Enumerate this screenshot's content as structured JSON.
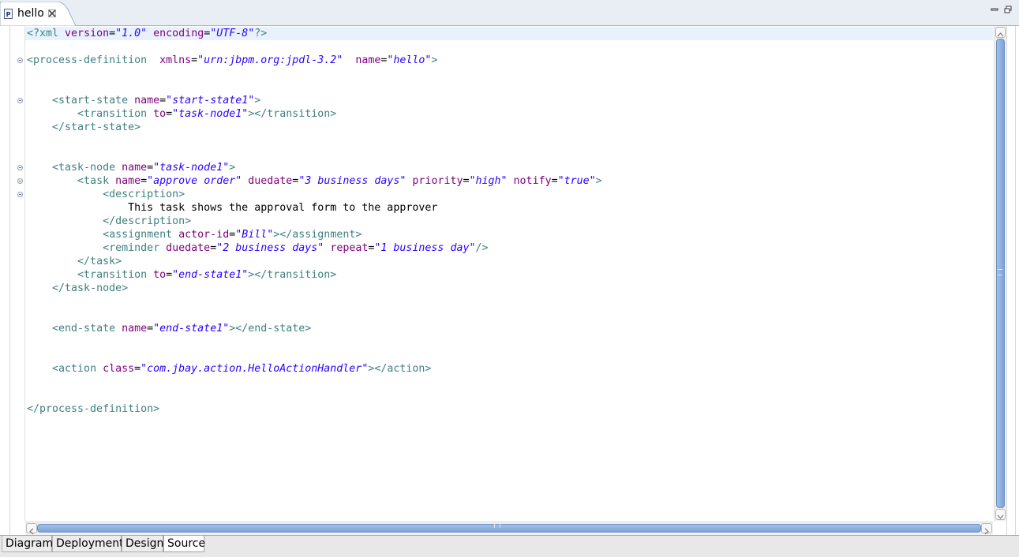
{
  "editor_tab": {
    "icon_letter": "P",
    "title": "hello"
  },
  "code_lines": [
    {
      "y": 0,
      "tokens": [
        [
          "t",
          "<?xml "
        ],
        [
          "a",
          "version"
        ],
        [
          "x",
          "="
        ],
        [
          "v",
          "\"1.0\""
        ],
        [
          "x",
          " "
        ],
        [
          "a",
          "encoding"
        ],
        [
          "x",
          "="
        ],
        [
          "v",
          "\"UTF-8\""
        ],
        [
          "t",
          "?>"
        ]
      ]
    },
    {
      "y": 2,
      "tokens": [
        [
          "t",
          "<process-definition  "
        ],
        [
          "a",
          "xmlns"
        ],
        [
          "x",
          "="
        ],
        [
          "v",
          "\"urn:jbpm.org:jpdl-3.2\""
        ],
        [
          "x",
          "  "
        ],
        [
          "a",
          "name"
        ],
        [
          "x",
          "="
        ],
        [
          "v",
          "\"hello\""
        ],
        [
          "t",
          ">"
        ]
      ]
    },
    {
      "y": 5,
      "tokens": [
        [
          "x",
          "    "
        ],
        [
          "t",
          "<start-state "
        ],
        [
          "a",
          "name"
        ],
        [
          "x",
          "="
        ],
        [
          "v",
          "\"start-state1\""
        ],
        [
          "t",
          ">"
        ]
      ]
    },
    {
      "y": 6,
      "tokens": [
        [
          "x",
          "        "
        ],
        [
          "t",
          "<transition "
        ],
        [
          "a",
          "to"
        ],
        [
          "x",
          "="
        ],
        [
          "v",
          "\"task-node1\""
        ],
        [
          "t",
          "></transition>"
        ]
      ]
    },
    {
      "y": 7,
      "tokens": [
        [
          "x",
          "    "
        ],
        [
          "t",
          "</start-state>"
        ]
      ]
    },
    {
      "y": 10,
      "tokens": [
        [
          "x",
          "    "
        ],
        [
          "t",
          "<task-node "
        ],
        [
          "a",
          "name"
        ],
        [
          "x",
          "="
        ],
        [
          "v",
          "\"task-node1\""
        ],
        [
          "t",
          ">"
        ]
      ]
    },
    {
      "y": 11,
      "tokens": [
        [
          "x",
          "        "
        ],
        [
          "t",
          "<task "
        ],
        [
          "a",
          "name"
        ],
        [
          "x",
          "="
        ],
        [
          "v",
          "\"approve order\""
        ],
        [
          "x",
          " "
        ],
        [
          "a",
          "duedate"
        ],
        [
          "x",
          "="
        ],
        [
          "v",
          "\"3 business days\""
        ],
        [
          "x",
          " "
        ],
        [
          "a",
          "priority"
        ],
        [
          "x",
          "="
        ],
        [
          "v",
          "\"high\""
        ],
        [
          "x",
          " "
        ],
        [
          "a",
          "notify"
        ],
        [
          "x",
          "="
        ],
        [
          "v",
          "\"true\""
        ],
        [
          "t",
          ">"
        ]
      ]
    },
    {
      "y": 12,
      "tokens": [
        [
          "x",
          "            "
        ],
        [
          "t",
          "<description>"
        ]
      ]
    },
    {
      "y": 13,
      "tokens": [
        [
          "x",
          "                This task shows the approval form to the approver"
        ]
      ]
    },
    {
      "y": 14,
      "tokens": [
        [
          "x",
          "            "
        ],
        [
          "t",
          "</description>"
        ]
      ]
    },
    {
      "y": 15,
      "tokens": [
        [
          "x",
          "            "
        ],
        [
          "t",
          "<assignment "
        ],
        [
          "a",
          "actor-id"
        ],
        [
          "x",
          "="
        ],
        [
          "v",
          "\"Bill\""
        ],
        [
          "t",
          "></assignment>"
        ]
      ]
    },
    {
      "y": 16,
      "tokens": [
        [
          "x",
          "            "
        ],
        [
          "t",
          "<reminder "
        ],
        [
          "a",
          "duedate"
        ],
        [
          "x",
          "="
        ],
        [
          "v",
          "\"2 business days\""
        ],
        [
          "x",
          " "
        ],
        [
          "a",
          "repeat"
        ],
        [
          "x",
          "="
        ],
        [
          "v",
          "\"1 business day\""
        ],
        [
          "t",
          "/>"
        ]
      ]
    },
    {
      "y": 17,
      "tokens": [
        [
          "x",
          "        "
        ],
        [
          "t",
          "</task>"
        ]
      ]
    },
    {
      "y": 18,
      "tokens": [
        [
          "x",
          "        "
        ],
        [
          "t",
          "<transition "
        ],
        [
          "a",
          "to"
        ],
        [
          "x",
          "="
        ],
        [
          "v",
          "\"end-state1\""
        ],
        [
          "t",
          "></transition>"
        ]
      ]
    },
    {
      "y": 19,
      "tokens": [
        [
          "x",
          "    "
        ],
        [
          "t",
          "</task-node>"
        ]
      ]
    },
    {
      "y": 22,
      "tokens": [
        [
          "x",
          "    "
        ],
        [
          "t",
          "<end-state "
        ],
        [
          "a",
          "name"
        ],
        [
          "x",
          "="
        ],
        [
          "v",
          "\"end-state1\""
        ],
        [
          "t",
          "></end-state>"
        ]
      ]
    },
    {
      "y": 25,
      "tokens": [
        [
          "x",
          "    "
        ],
        [
          "t",
          "<action "
        ],
        [
          "a",
          "class"
        ],
        [
          "x",
          "="
        ],
        [
          "v",
          "\"com.jbay.action.HelloActionHandler\""
        ],
        [
          "t",
          "></action>"
        ]
      ]
    },
    {
      "y": 28,
      "tokens": [
        [
          "t",
          "</process-definition>"
        ]
      ]
    }
  ],
  "fold_markers_lines": [
    2,
    5,
    10,
    11,
    12
  ],
  "page_tabs": [
    {
      "label": "Diagram",
      "active": false
    },
    {
      "label": "Deployment",
      "active": false
    },
    {
      "label": "Design",
      "active": false
    },
    {
      "label": "Source",
      "active": true
    }
  ],
  "colors": {
    "tag": "#3f7f7f",
    "attribute": "#7f007f",
    "value": "#2a00ff",
    "scrollbar": "#7ea3d8"
  }
}
